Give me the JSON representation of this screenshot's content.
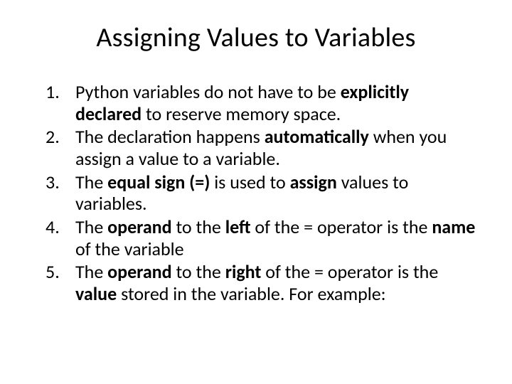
{
  "title": "Assigning Values to Variables",
  "items": [
    {
      "pre": "Python variables do not have to be ",
      "b1": "explicitly declared",
      "post": " to reserve memory space."
    },
    {
      "pre": "The declaration happens ",
      "b1": "automatically",
      "post": " when you assign a value to a variable."
    },
    {
      "pre": "The ",
      "b1": "equal sign (=)",
      "mid": " is used to ",
      "b2": "assign",
      "post": " values to variables."
    },
    {
      "pre": "The ",
      "b1": "operand",
      "mid": " to the ",
      "b2": "left",
      "mid2": " of the = operator is the ",
      "b3": "name",
      "post": " of the variable"
    },
    {
      "pre": "The ",
      "b1": "operand",
      "mid": " to the ",
      "b2": "right",
      "mid2": " of the = operator is the ",
      "b3": "value",
      "post": " stored in the variable. For example:"
    }
  ]
}
